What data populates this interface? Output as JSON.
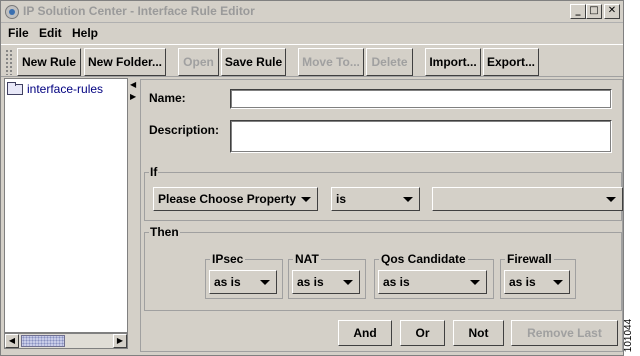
{
  "window": {
    "title": "IP Solution Center - Interface Rule Editor",
    "controls": {
      "minimize": "_",
      "maximize": "□",
      "close": "✕"
    }
  },
  "menu": {
    "file": "File",
    "edit": "Edit",
    "help": "Help"
  },
  "toolbar": {
    "new_rule": "New Rule",
    "new_folder": "New Folder...",
    "open": "Open",
    "save_rule": "Save Rule",
    "move_to": "Move To...",
    "delete": "Delete",
    "import": "Import...",
    "export": "Export..."
  },
  "tree": {
    "root_label": "interface-rules"
  },
  "form": {
    "name_label": "Name:",
    "name_value": "",
    "description_label": "Description:",
    "description_value": ""
  },
  "if_section": {
    "title": "If",
    "property_select": "Please Choose Property",
    "operator_select": "is",
    "value_select": ""
  },
  "then_section": {
    "title": "Then",
    "ipsec": {
      "label": "IPsec",
      "value": "as is"
    },
    "nat": {
      "label": "NAT",
      "value": "as is"
    },
    "qos": {
      "label": "Qos Candidate",
      "value": "as is"
    },
    "firewall": {
      "label": "Firewall",
      "value": "as is"
    }
  },
  "actions": {
    "and": "And",
    "or": "Or",
    "not": "Not",
    "remove_last": "Remove Last"
  },
  "figure_id": "101044",
  "icons": [
    "app-icon",
    "folder-icon",
    "chevron-left-icon",
    "chevron-right-icon",
    "chevron-down-icon"
  ]
}
